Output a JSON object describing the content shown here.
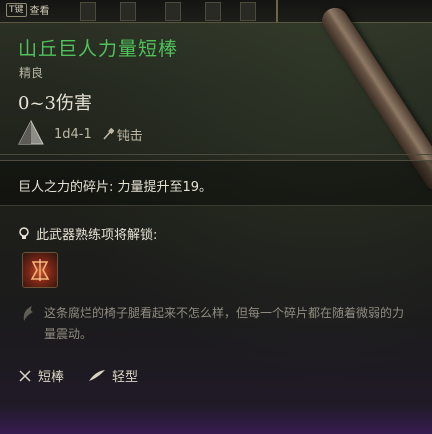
{
  "top_bar": {
    "key_label": "T键",
    "action_label": "查看"
  },
  "item": {
    "name": "山丘巨人力量短棒",
    "rarity": "精良",
    "damage": "0~3伤害",
    "dice": "1d4-1",
    "damage_type": "钝击",
    "ability": "巨人之力的碎片: 力量提升至19。",
    "unlock_heading": "此武器熟练项将解锁:",
    "flavor_text": "这条腐烂的椅子腿看起来不怎么样，但每一个碎片都在随着微弱的力量震动。",
    "tags": [
      "短棒",
      "轻型"
    ]
  },
  "colors": {
    "name_color": "#4fc25a",
    "text_color": "#e6e2d4",
    "muted_color": "#8f8c80"
  },
  "icons": [
    "d4-die-icon",
    "bludgeon-icon",
    "lightbulb-icon",
    "weapon-mastery-icon",
    "quill-icon",
    "club-tag-icon",
    "feather-icon",
    "club-weapon-art"
  ]
}
